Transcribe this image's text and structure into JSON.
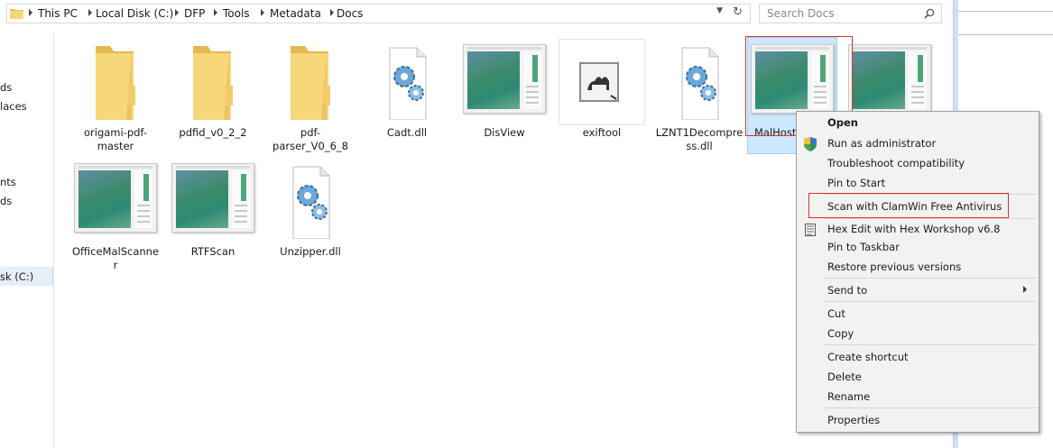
{
  "breadcrumb": [
    "This PC",
    "Local Disk (C:)",
    "DFP",
    "Tools",
    "Metadata",
    "Docs"
  ],
  "search": {
    "placeholder": "Search Docs"
  },
  "nav": {
    "items": [
      "ds",
      "laces",
      "nts",
      "ds",
      "sk (C:)"
    ]
  },
  "items": [
    {
      "label": "origami-pdf-master",
      "type": "folder"
    },
    {
      "label": "pdfid_v0_2_2",
      "type": "folder"
    },
    {
      "label": "pdf-parser_V0_6_8",
      "type": "folder"
    },
    {
      "label": "Cadt.dll",
      "type": "dll"
    },
    {
      "label": "DisView",
      "type": "app"
    },
    {
      "label": "exiftool",
      "type": "exiftool"
    },
    {
      "label": "LZNT1Decompress.dll",
      "type": "dll"
    },
    {
      "label": "MalHost",
      "type": "app",
      "selected": true
    },
    {
      "label": "",
      "type": "app"
    },
    {
      "label": "OfficeMalScanner",
      "type": "app"
    },
    {
      "label": "RTFScan",
      "type": "app"
    },
    {
      "label": "Unzipper.dll",
      "type": "dll"
    }
  ],
  "context_menu": {
    "items": [
      "Open",
      "Run as administrator",
      "Troubleshoot compatibility",
      "Pin to Start",
      "Scan with ClamWin Free Antivirus",
      "Hex Edit with Hex Workshop v6.8",
      "Pin to Taskbar",
      "Restore previous versions",
      "Send to",
      "Cut",
      "Copy",
      "Create shortcut",
      "Delete",
      "Rename",
      "Properties"
    ]
  },
  "colors": {
    "highlight": "#cce8ff",
    "annotation_red": "#e03030"
  }
}
